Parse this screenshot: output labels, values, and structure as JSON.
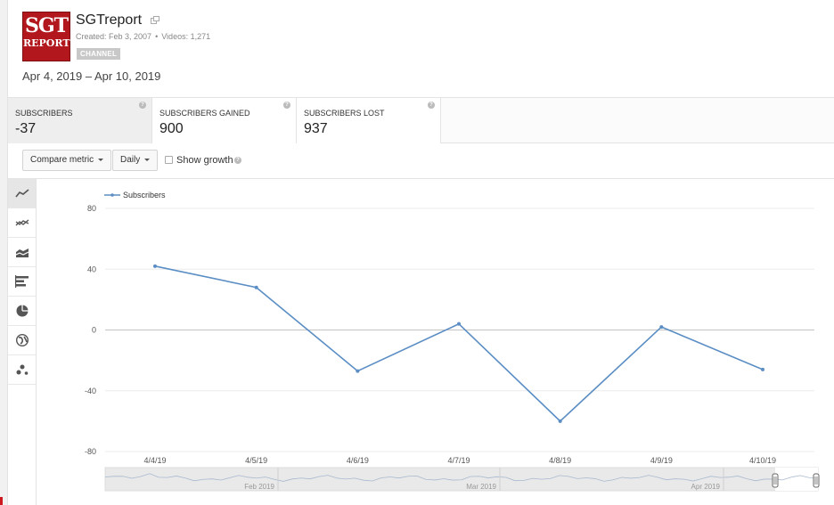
{
  "channel": {
    "logo_line1": "SGT",
    "logo_line2": "REPORT",
    "name": "SGTreport",
    "created": "Created: Feb 3, 2007",
    "videos": "Videos: 1,271",
    "badge": "CHANNEL"
  },
  "date_range": "Apr 4, 2019 – Apr 10, 2019",
  "metrics": [
    {
      "label": "SUBSCRIBERS",
      "value": "-37",
      "active": true
    },
    {
      "label": "SUBSCRIBERS GAINED",
      "value": "900",
      "active": false
    },
    {
      "label": "SUBSCRIBERS LOST",
      "value": "937",
      "active": false
    }
  ],
  "controls": {
    "compare_metric": "Compare metric",
    "interval": "Daily",
    "show_growth": "Show growth",
    "show_growth_checked": false
  },
  "chart_types": [
    {
      "icon": "line-chart-icon",
      "active": true
    },
    {
      "icon": "multi-line-chart-icon",
      "active": false
    },
    {
      "icon": "stacked-area-chart-icon",
      "active": false
    },
    {
      "icon": "bar-chart-icon",
      "active": false
    },
    {
      "icon": "pie-chart-icon",
      "active": false
    },
    {
      "icon": "globe-map-icon",
      "active": false
    },
    {
      "icon": "bubble-chart-icon",
      "active": false
    }
  ],
  "chart_data": {
    "type": "line",
    "categories": [
      "4/4/19",
      "4/5/19",
      "4/6/19",
      "4/7/19",
      "4/8/19",
      "4/9/19",
      "4/10/19"
    ],
    "series": [
      {
        "name": "Subscribers",
        "values": [
          42,
          28,
          -27,
          4,
          -60,
          2,
          -26
        ]
      }
    ],
    "ylim": [
      -80,
      80
    ],
    "yticks": [
      "80",
      "40",
      "0",
      "-40",
      "-80"
    ],
    "grid": true,
    "legend_position": "top-left",
    "color": "#5b8ec4",
    "overview_labels": [
      "Feb 2019",
      "Mar 2019",
      "Apr 2019"
    ]
  }
}
